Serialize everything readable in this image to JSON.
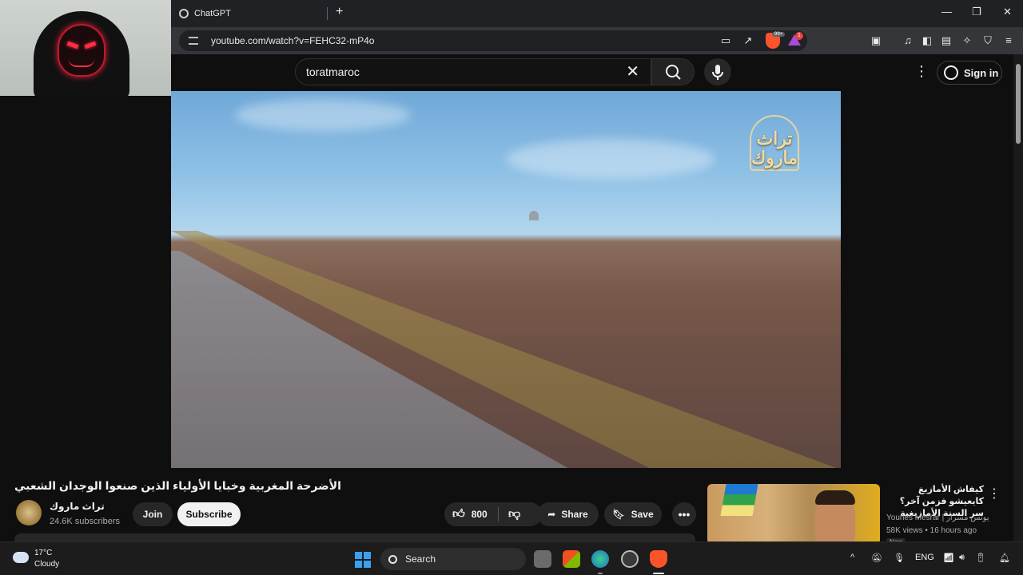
{
  "webcam": {},
  "browser": {
    "tab": {
      "title": "ChatGPT"
    },
    "new_tab": "+",
    "url": "youtube.com/watch?v=FEHC32-mP4o",
    "brave_shield_count": "99+",
    "rewards_count": "1"
  },
  "youtube": {
    "search": {
      "query": "toratmaroc",
      "clear": "✕"
    },
    "sign_in": "Sign in",
    "watermark": "تراث ماروك",
    "video": {
      "title": "الأضرحة المغربية وخبايا الأولياء الذين صنعوا الوجدان الشعبي",
      "channel": "تراث ماروك",
      "subscribers": "24.6K subscribers",
      "join": "Join",
      "subscribe": "Subscribe",
      "likes": "800",
      "share": "Share",
      "save": "Save",
      "more": "•••"
    },
    "recommended": {
      "title": "كيفاش الأمازيغ كايعيشو فزمن آخر؟ سر السنة الأمازيغية",
      "channel": "Younes Mesrar | يونس مسرار",
      "meta": "58K views • 16 hours ago",
      "badge": "New"
    }
  },
  "taskbar": {
    "weather_temp": "17°C",
    "weather_desc": "Cloudy",
    "search": "Search",
    "language": "ENG"
  },
  "colors": {
    "accent": "#3aa0f0",
    "brave": "#fb542b",
    "yt_bg": "#0f0f0f"
  }
}
